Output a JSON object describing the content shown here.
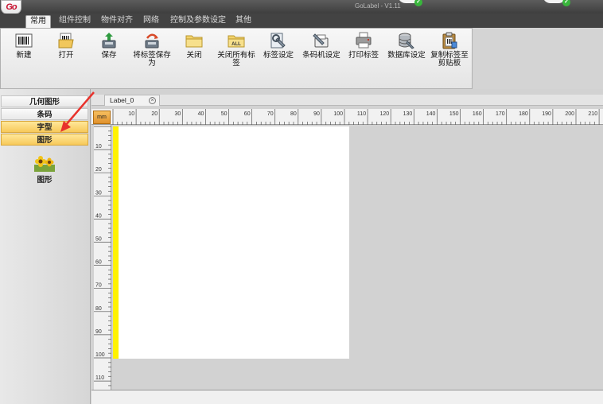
{
  "window": {
    "title": "GoLabel - V1.11",
    "logo_text": "Go"
  },
  "tabs": [
    {
      "label": "常用",
      "active": true
    },
    {
      "label": "组件控制"
    },
    {
      "label": "物件对齐"
    },
    {
      "label": "网络"
    },
    {
      "label": "控制及参数设定"
    },
    {
      "label": "其他"
    }
  ],
  "toolbar": [
    {
      "label": "新建",
      "icon": "barcode-new-icon"
    },
    {
      "label": "打开",
      "icon": "open-folder-icon"
    },
    {
      "label": "保存",
      "icon": "save-icon"
    },
    {
      "label": "将标签保存为",
      "icon": "save-as-icon"
    },
    {
      "label": "关闭",
      "icon": "close-folder-icon"
    },
    {
      "label": "关闭所有标签",
      "icon": "close-all-icon"
    },
    {
      "label": "标签设定",
      "icon": "label-settings-icon"
    },
    {
      "label": "条码机设定",
      "icon": "printer-settings-icon"
    },
    {
      "label": "打印标签",
      "icon": "print-icon"
    },
    {
      "label": "数据库设定",
      "icon": "database-icon"
    },
    {
      "label": "复制标签至剪贴板",
      "icon": "clipboard-icon"
    }
  ],
  "left_panel": {
    "categories": [
      {
        "label": "几何图形",
        "selected": false
      },
      {
        "label": "条码",
        "selected": false
      },
      {
        "label": "字型",
        "selected": true
      },
      {
        "label": "图形",
        "selected": true
      }
    ],
    "shape_item": {
      "label": "图形",
      "icon": "flower-image-icon"
    }
  },
  "document": {
    "tab_label": "Label_0",
    "unit": "mm",
    "h_ruler_labels": [
      "10",
      "20",
      "30",
      "40",
      "50",
      "60",
      "70",
      "80",
      "90",
      "100",
      "110",
      "120",
      "130",
      "140",
      "150",
      "160",
      "170",
      "180",
      "190",
      "200",
      "210"
    ],
    "v_ruler_labels": [
      "10",
      "20",
      "30",
      "40",
      "50",
      "60",
      "70",
      "80",
      "90",
      "100",
      "110"
    ]
  },
  "colors": {
    "accent": "#f7c95a",
    "canvas_margin": "#fff200",
    "arrow": "#e8322c"
  }
}
